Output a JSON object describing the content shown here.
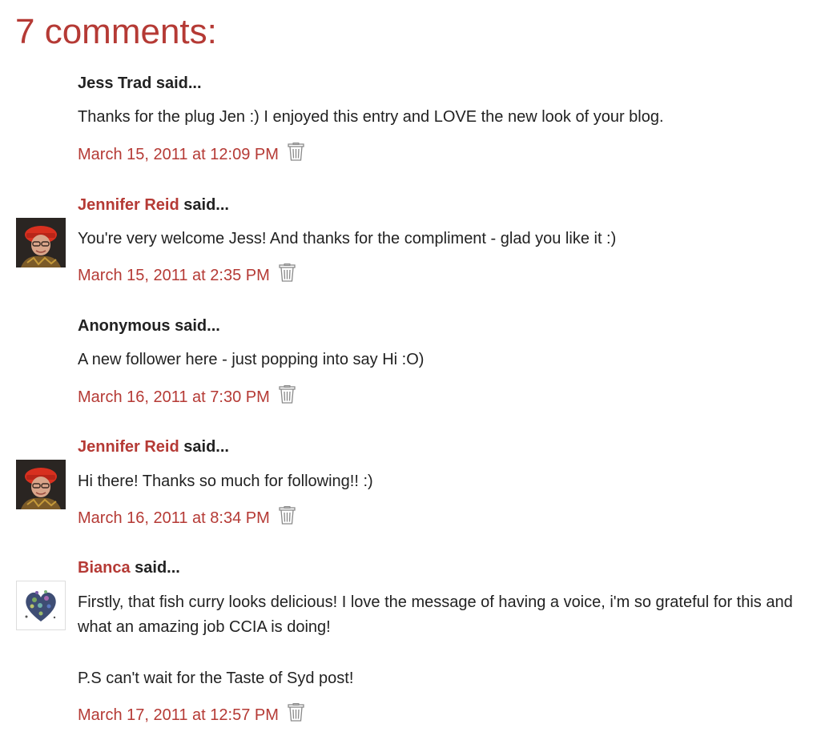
{
  "heading": "7 comments:",
  "said_suffix": "said...",
  "comments": [
    {
      "author": "Jess Trad",
      "author_linked": false,
      "avatar": "none",
      "body": [
        "Thanks for the plug Jen :) I enjoyed this entry and LOVE the new look of your blog."
      ],
      "timestamp": "March 15, 2011 at 12:09 PM"
    },
    {
      "author": "Jennifer Reid",
      "author_linked": true,
      "avatar": "profile-photo-red-hat",
      "body": [
        "You're very welcome Jess! And thanks for the compliment - glad you like it :)"
      ],
      "timestamp": "March 15, 2011 at 2:35 PM"
    },
    {
      "author": "Anonymous",
      "author_linked": false,
      "avatar": "none",
      "body": [
        "A new follower here - just popping into say Hi :O)"
      ],
      "timestamp": "March 16, 2011 at 7:30 PM"
    },
    {
      "author": "Jennifer Reid",
      "author_linked": true,
      "avatar": "profile-photo-red-hat",
      "body": [
        "Hi there! Thanks so much for following!! :)"
      ],
      "timestamp": "March 16, 2011 at 8:34 PM"
    },
    {
      "author": "Bianca",
      "author_linked": true,
      "avatar": "mosaic-heart",
      "body": [
        "Firstly, that fish curry looks delicious! I love the message of having a voice, i'm so grateful for this and what an amazing job CCIA is doing!",
        "P.S can't wait for the Taste of Syd post!"
      ],
      "timestamp": "March 17, 2011 at 12:57 PM"
    }
  ],
  "icons": {
    "delete": "trash-icon"
  },
  "colors": {
    "accent": "#b53a35",
    "text": "#222222",
    "icon": "#8a8a8a"
  }
}
